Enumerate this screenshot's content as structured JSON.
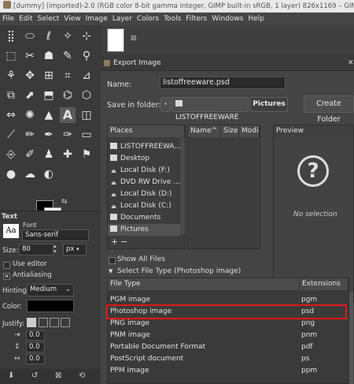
{
  "window": {
    "title": "[dummy] (imported)-2.0 (RGB color 8-bit gamma integer, GIMP built-in sRGB, 1 layer) 826x1169 – GIMP"
  },
  "menu": [
    "File",
    "Edit",
    "Select",
    "View",
    "Image",
    "Layer",
    "Colors",
    "Tools",
    "Filters",
    "Windows",
    "Help"
  ],
  "tool_options": {
    "section": "Text",
    "font_label": "Font",
    "font_value": "Sans-serif",
    "size_label": "Size:",
    "size_value": "80",
    "size_unit": "px",
    "use_editor": "Use editor",
    "antialiasing": "Antialiasing",
    "hinting_label": "Hinting:",
    "hinting_value": "Medium",
    "color_label": "Color:",
    "justify_label": "Justify:",
    "indent_value": "0.0",
    "line_spacing_value": "0.0",
    "letter_spacing_value": "0.0"
  },
  "dialog": {
    "title": "Export Image",
    "name_label": "Name:",
    "name_value": "listoffreeware.psd",
    "save_in_label": "Save in folder:",
    "breadcrumb_1": "LISTOFFREEWARE",
    "breadcrumb_2": "Pictures",
    "create_folder": "Create Folder",
    "places_header": "Places",
    "places": [
      "LISTOFFREEWA...",
      "Desktop",
      "Local Disk (F:)",
      "DVD RW Drive ...",
      "Local Disk (D:)",
      "Local Disk (C:)",
      "Documents",
      "Pictures"
    ],
    "col_name": "Name",
    "col_size": "Size",
    "col_modified": "Modi",
    "preview_header": "Preview",
    "no_selection": "No selection",
    "add_symbol": "+",
    "remove_symbol": "−",
    "show_all_files": "Show All Files",
    "select_file_type": "Select File Type (Photoshop image)",
    "filetype_header": "File Type",
    "ext_header": "Extensions",
    "filetypes": [
      {
        "name": "PGM image",
        "ext": "pgm"
      },
      {
        "name": "Photoshop image",
        "ext": "psd"
      },
      {
        "name": "PNG image",
        "ext": "png"
      },
      {
        "name": "PNM image",
        "ext": "pnm"
      },
      {
        "name": "Portable Document Format",
        "ext": "pdf"
      },
      {
        "name": "PostScript document",
        "ext": "ps"
      },
      {
        "name": "PPM image",
        "ext": "ppm"
      }
    ]
  }
}
